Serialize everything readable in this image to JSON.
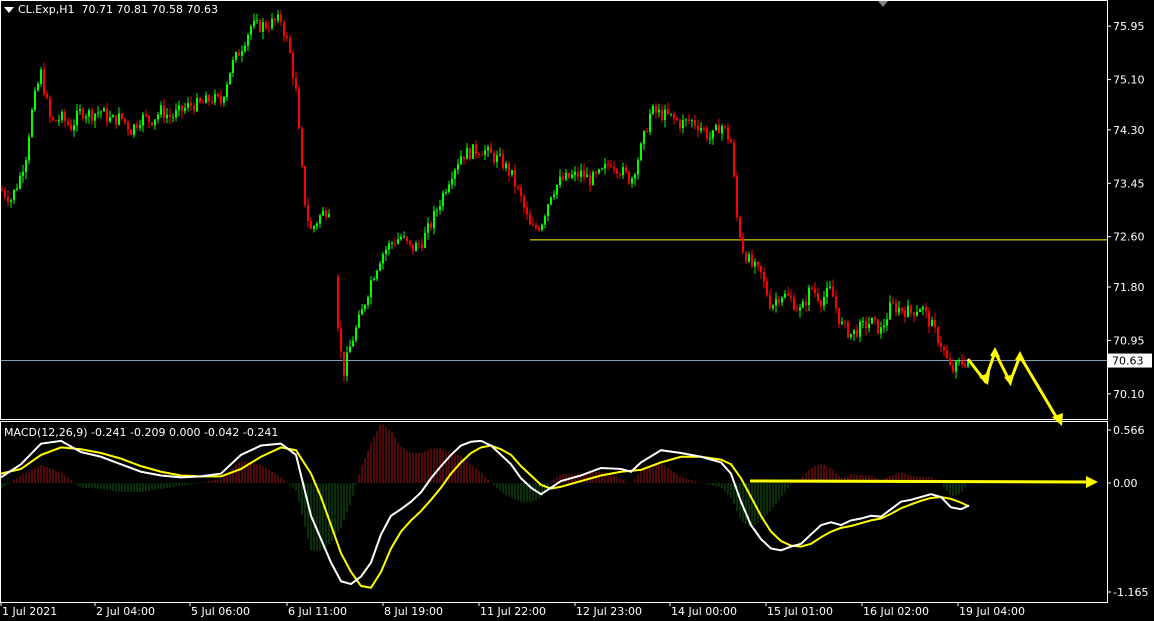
{
  "header": {
    "symbol": "CL.Exp,H1",
    "ohlc": "70.71 70.81 70.58 70.63"
  },
  "macd": {
    "label": "MACD(12,26,9) -0.241 -0.209 0.000 -0.042 -0.241"
  },
  "colors": {
    "background": "#000000",
    "bull_candle": "#00ff00",
    "bear_candle": "#ff0000",
    "frame": "#ffffff",
    "annotation": "#ffff00",
    "price_line": "#7f9fbf",
    "macd_line": "#ffffff",
    "signal_line": "#ffff00",
    "hist_pos": "#a01010",
    "hist_neg": "#106010"
  },
  "chart_data": [
    {
      "type": "candlestick",
      "title": "CL.Exp,H1",
      "y_ticks": [
        "75.95",
        "75.10",
        "74.30",
        "73.45",
        "72.60",
        "71.80",
        "70.95",
        "70.10"
      ],
      "ylim": [
        69.7,
        76.35
      ],
      "current_price": "70.63",
      "x_ticks": [
        "1 Jul 2021",
        "2 Jul 04:00",
        "5 Jul 06:00",
        "6 Jul 11:00",
        "8 Jul 19:00",
        "11 Jul 22:00",
        "12 Jul 23:00",
        "14 Jul 00:00",
        "15 Jul 01:00",
        "16 Jul 02:00",
        "19 Jul 04:00"
      ],
      "horizontal_lines": [
        72.55,
        70.63
      ],
      "close_path": [
        [
          0,
          73.35
        ],
        [
          10,
          73.2
        ],
        [
          18,
          73.5
        ],
        [
          25,
          73.9
        ],
        [
          30,
          74.5
        ],
        [
          35,
          74.9
        ],
        [
          40,
          75.2
        ],
        [
          45,
          74.8
        ],
        [
          50,
          74.4
        ],
        [
          60,
          74.5
        ],
        [
          70,
          74.35
        ],
        [
          80,
          74.6
        ],
        [
          90,
          74.55
        ],
        [
          100,
          74.6
        ],
        [
          110,
          74.45
        ],
        [
          120,
          74.5
        ],
        [
          130,
          74.3
        ],
        [
          140,
          74.5
        ],
        [
          150,
          74.45
        ],
        [
          160,
          74.6
        ],
        [
          170,
          74.5
        ],
        [
          180,
          74.6
        ],
        [
          190,
          74.7
        ],
        [
          200,
          74.7
        ],
        [
          210,
          74.8
        ],
        [
          220,
          74.75
        ],
        [
          230,
          75.3
        ],
        [
          240,
          75.6
        ],
        [
          250,
          75.95
        ],
        [
          260,
          75.95
        ],
        [
          270,
          76.0
        ],
        [
          280,
          76.05
        ],
        [
          288,
          75.6
        ],
        [
          295,
          74.9
        ],
        [
          300,
          73.8
        ],
        [
          305,
          73.0
        ],
        [
          310,
          72.7
        ],
        [
          320,
          72.95
        ],
        [
          330,
          73.1
        ],
        [
          336,
          71.4
        ],
        [
          342,
          70.4
        ],
        [
          350,
          70.9
        ],
        [
          360,
          71.35
        ],
        [
          370,
          71.9
        ],
        [
          380,
          72.3
        ],
        [
          390,
          72.5
        ],
        [
          400,
          72.6
        ],
        [
          410,
          72.4
        ],
        [
          420,
          72.5
        ],
        [
          430,
          72.8
        ],
        [
          440,
          73.2
        ],
        [
          450,
          73.6
        ],
        [
          460,
          73.9
        ],
        [
          470,
          73.95
        ],
        [
          480,
          74.0
        ],
        [
          490,
          73.9
        ],
        [
          500,
          73.8
        ],
        [
          510,
          73.6
        ],
        [
          520,
          73.2
        ],
        [
          530,
          72.7
        ],
        [
          540,
          72.8
        ],
        [
          550,
          73.3
        ],
        [
          560,
          73.5
        ],
        [
          570,
          73.55
        ],
        [
          580,
          73.6
        ],
        [
          590,
          73.5
        ],
        [
          600,
          73.6
        ],
        [
          610,
          73.8
        ],
        [
          620,
          73.65
        ],
        [
          630,
          73.5
        ],
        [
          640,
          74.0
        ],
        [
          650,
          74.6
        ],
        [
          660,
          74.55
        ],
        [
          670,
          74.5
        ],
        [
          680,
          74.4
        ],
        [
          690,
          74.45
        ],
        [
          700,
          74.35
        ],
        [
          710,
          74.15
        ],
        [
          720,
          74.4
        ],
        [
          730,
          74.1
        ],
        [
          736,
          72.9
        ],
        [
          742,
          72.4
        ],
        [
          750,
          72.15
        ],
        [
          760,
          72.0
        ],
        [
          770,
          71.5
        ],
        [
          780,
          71.7
        ],
        [
          790,
          71.6
        ],
        [
          800,
          71.4
        ],
        [
          810,
          71.8
        ],
        [
          820,
          71.6
        ],
        [
          830,
          71.75
        ],
        [
          840,
          71.2
        ],
        [
          850,
          71.05
        ],
        [
          860,
          71.15
        ],
        [
          870,
          71.25
        ],
        [
          880,
          71.1
        ],
        [
          890,
          71.5
        ],
        [
          900,
          71.45
        ],
        [
          910,
          71.4
        ],
        [
          920,
          71.5
        ],
        [
          930,
          71.2
        ],
        [
          940,
          70.9
        ],
        [
          950,
          70.45
        ],
        [
          960,
          70.6
        ],
        [
          968,
          70.63
        ]
      ],
      "annotations": "yellow zigzag arrow projection to the bottom-right"
    },
    {
      "type": "line",
      "title": "MACD(12,26,9)",
      "y_ticks": [
        "0.566",
        "0.00",
        "-1.165"
      ],
      "ylim": [
        -1.165,
        0.566
      ],
      "series": [
        {
          "name": "MACD",
          "values": [
            [
              0,
              0.06
            ],
            [
              20,
              0.2
            ],
            [
              40,
              0.42
            ],
            [
              60,
              0.45
            ],
            [
              80,
              0.33
            ],
            [
              100,
              0.28
            ],
            [
              120,
              0.2
            ],
            [
              140,
              0.12
            ],
            [
              160,
              0.08
            ],
            [
              180,
              0.06
            ],
            [
              200,
              0.07
            ],
            [
              220,
              0.1
            ],
            [
              240,
              0.3
            ],
            [
              260,
              0.4
            ],
            [
              280,
              0.42
            ],
            [
              295,
              0.3
            ],
            [
              310,
              -0.35
            ],
            [
              320,
              -0.6
            ],
            [
              330,
              -0.85
            ],
            [
              340,
              -1.05
            ],
            [
              350,
              -1.08
            ],
            [
              360,
              -1.0
            ],
            [
              370,
              -0.85
            ],
            [
              380,
              -0.55
            ],
            [
              390,
              -0.35
            ],
            [
              400,
              -0.28
            ],
            [
              410,
              -0.2
            ],
            [
              420,
              -0.1
            ],
            [
              430,
              0.05
            ],
            [
              440,
              0.18
            ],
            [
              450,
              0.3
            ],
            [
              460,
              0.4
            ],
            [
              470,
              0.44
            ],
            [
              480,
              0.45
            ],
            [
              490,
              0.4
            ],
            [
              500,
              0.3
            ],
            [
              510,
              0.2
            ],
            [
              520,
              0.05
            ],
            [
              530,
              -0.05
            ],
            [
              540,
              -0.12
            ],
            [
              550,
              -0.05
            ],
            [
              560,
              0.02
            ],
            [
              580,
              0.08
            ],
            [
              600,
              0.16
            ],
            [
              620,
              0.15
            ],
            [
              630,
              0.12
            ],
            [
              640,
              0.22
            ],
            [
              660,
              0.35
            ],
            [
              680,
              0.32
            ],
            [
              700,
              0.28
            ],
            [
              720,
              0.22
            ],
            [
              730,
              0.1
            ],
            [
              740,
              -0.2
            ],
            [
              750,
              -0.45
            ],
            [
              760,
              -0.6
            ],
            [
              770,
              -0.7
            ],
            [
              780,
              -0.72
            ],
            [
              790,
              -0.68
            ],
            [
              800,
              -0.65
            ],
            [
              810,
              -0.55
            ],
            [
              820,
              -0.45
            ],
            [
              830,
              -0.42
            ],
            [
              840,
              -0.45
            ],
            [
              850,
              -0.4
            ],
            [
              860,
              -0.38
            ],
            [
              870,
              -0.35
            ],
            [
              880,
              -0.36
            ],
            [
              890,
              -0.28
            ],
            [
              900,
              -0.2
            ],
            [
              910,
              -0.18
            ],
            [
              920,
              -0.15
            ],
            [
              930,
              -0.12
            ],
            [
              940,
              -0.15
            ],
            [
              950,
              -0.26
            ],
            [
              960,
              -0.28
            ],
            [
              968,
              -0.241
            ]
          ]
        },
        {
          "name": "Signal",
          "values": [
            [
              0,
              0.1
            ],
            [
              20,
              0.15
            ],
            [
              40,
              0.3
            ],
            [
              60,
              0.38
            ],
            [
              80,
              0.36
            ],
            [
              100,
              0.32
            ],
            [
              120,
              0.26
            ],
            [
              140,
              0.18
            ],
            [
              160,
              0.12
            ],
            [
              180,
              0.08
            ],
            [
              200,
              0.07
            ],
            [
              220,
              0.07
            ],
            [
              240,
              0.15
            ],
            [
              260,
              0.28
            ],
            [
              280,
              0.38
            ],
            [
              295,
              0.35
            ],
            [
              310,
              0.1
            ],
            [
              320,
              -0.15
            ],
            [
              330,
              -0.45
            ],
            [
              340,
              -0.75
            ],
            [
              350,
              -0.95
            ],
            [
              360,
              -1.1
            ],
            [
              370,
              -1.12
            ],
            [
              380,
              -0.95
            ],
            [
              390,
              -0.7
            ],
            [
              400,
              -0.52
            ],
            [
              410,
              -0.4
            ],
            [
              420,
              -0.3
            ],
            [
              430,
              -0.18
            ],
            [
              440,
              -0.05
            ],
            [
              450,
              0.1
            ],
            [
              460,
              0.22
            ],
            [
              470,
              0.32
            ],
            [
              480,
              0.38
            ],
            [
              490,
              0.4
            ],
            [
              500,
              0.36
            ],
            [
              510,
              0.3
            ],
            [
              520,
              0.18
            ],
            [
              530,
              0.08
            ],
            [
              540,
              -0.02
            ],
            [
              550,
              -0.06
            ],
            [
              560,
              -0.04
            ],
            [
              580,
              0.02
            ],
            [
              600,
              0.08
            ],
            [
              620,
              0.12
            ],
            [
              640,
              0.14
            ],
            [
              660,
              0.22
            ],
            [
              680,
              0.28
            ],
            [
              700,
              0.28
            ],
            [
              720,
              0.25
            ],
            [
              730,
              0.2
            ],
            [
              740,
              0.05
            ],
            [
              750,
              -0.15
            ],
            [
              760,
              -0.35
            ],
            [
              770,
              -0.52
            ],
            [
              780,
              -0.62
            ],
            [
              790,
              -0.67
            ],
            [
              800,
              -0.68
            ],
            [
              810,
              -0.65
            ],
            [
              820,
              -0.58
            ],
            [
              830,
              -0.52
            ],
            [
              840,
              -0.48
            ],
            [
              850,
              -0.46
            ],
            [
              860,
              -0.43
            ],
            [
              870,
              -0.4
            ],
            [
              880,
              -0.38
            ],
            [
              890,
              -0.33
            ],
            [
              900,
              -0.27
            ],
            [
              910,
              -0.23
            ],
            [
              920,
              -0.19
            ],
            [
              930,
              -0.16
            ],
            [
              940,
              -0.15
            ],
            [
              950,
              -0.17
            ],
            [
              960,
              -0.21
            ],
            [
              968,
              -0.25
            ]
          ]
        }
      ]
    }
  ]
}
